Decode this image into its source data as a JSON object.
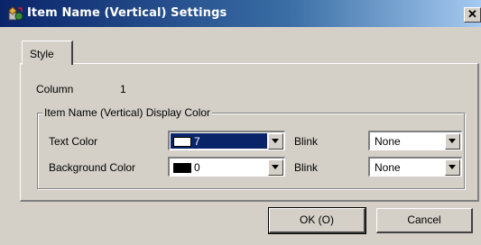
{
  "window": {
    "title": "Item Name (Vertical) Settings",
    "close_label": "✕"
  },
  "tabs": [
    {
      "label": "Style"
    }
  ],
  "column": {
    "label": "Column",
    "value": "1"
  },
  "group": {
    "title": "Item Name (Vertical) Display Color",
    "text_color": {
      "label": "Text Color",
      "value": "7",
      "swatch": "#ffffff",
      "blink_label": "Blink",
      "blink_value": "None"
    },
    "background_color": {
      "label": "Background Color",
      "value": "0",
      "swatch": "#000000",
      "blink_label": "Blink",
      "blink_value": "None"
    }
  },
  "buttons": {
    "ok": "OK (O)",
    "cancel": "Cancel"
  }
}
